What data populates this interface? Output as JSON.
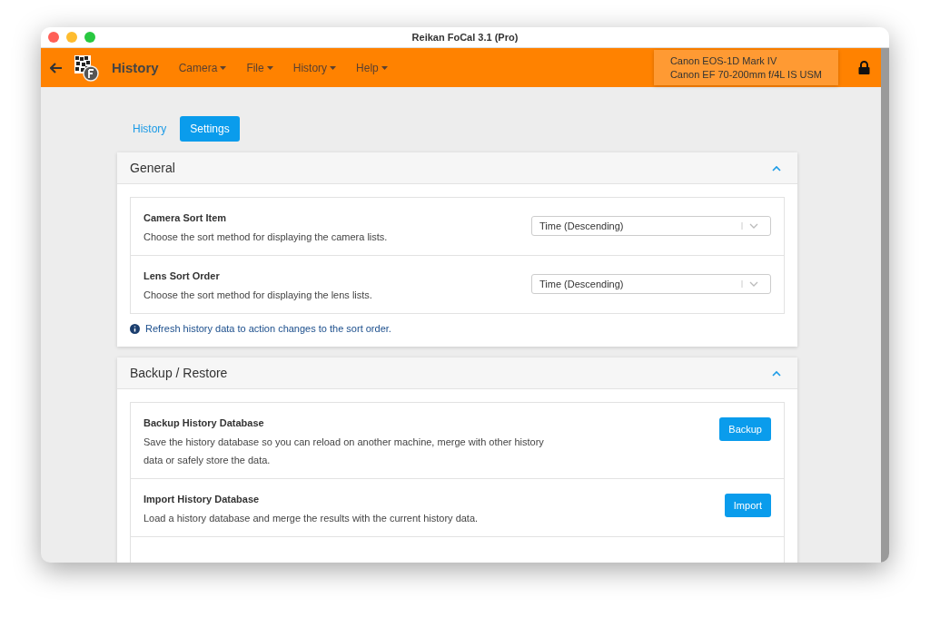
{
  "window": {
    "title": "Reikan FoCal 3.1 (Pro)"
  },
  "toolbar": {
    "title": "History",
    "menus": [
      "Camera",
      "File",
      "History",
      "Help"
    ]
  },
  "device": {
    "camera": "Canon EOS-1D Mark IV",
    "lens": "Canon EF 70-200mm f/4L IS USM"
  },
  "tabs": [
    {
      "label": "History",
      "selected": false
    },
    {
      "label": "Settings",
      "selected": true
    }
  ],
  "sections": [
    {
      "title": "General",
      "expanded": true,
      "rows": [
        {
          "kind": "select",
          "title": "Camera Sort Item",
          "description": "Choose the sort method for displaying the camera lists.",
          "value": "Time (Descending)"
        },
        {
          "kind": "select",
          "title": "Lens Sort Order",
          "description": "Choose the sort method for displaying the lens lists.",
          "value": "Time (Descending)"
        }
      ],
      "note": "Refresh history data to action changes to the sort order."
    },
    {
      "title": "Backup / Restore",
      "expanded": true,
      "rows": [
        {
          "kind": "button",
          "title": "Backup History Database",
          "description": "Save the history database so you can reload on another machine, merge with other history data or safely store the data.",
          "button": "Backup"
        },
        {
          "kind": "button",
          "title": "Import History Database",
          "description": "Load a history database and merge the results with the current history data.",
          "button": "Import"
        }
      ]
    }
  ]
}
